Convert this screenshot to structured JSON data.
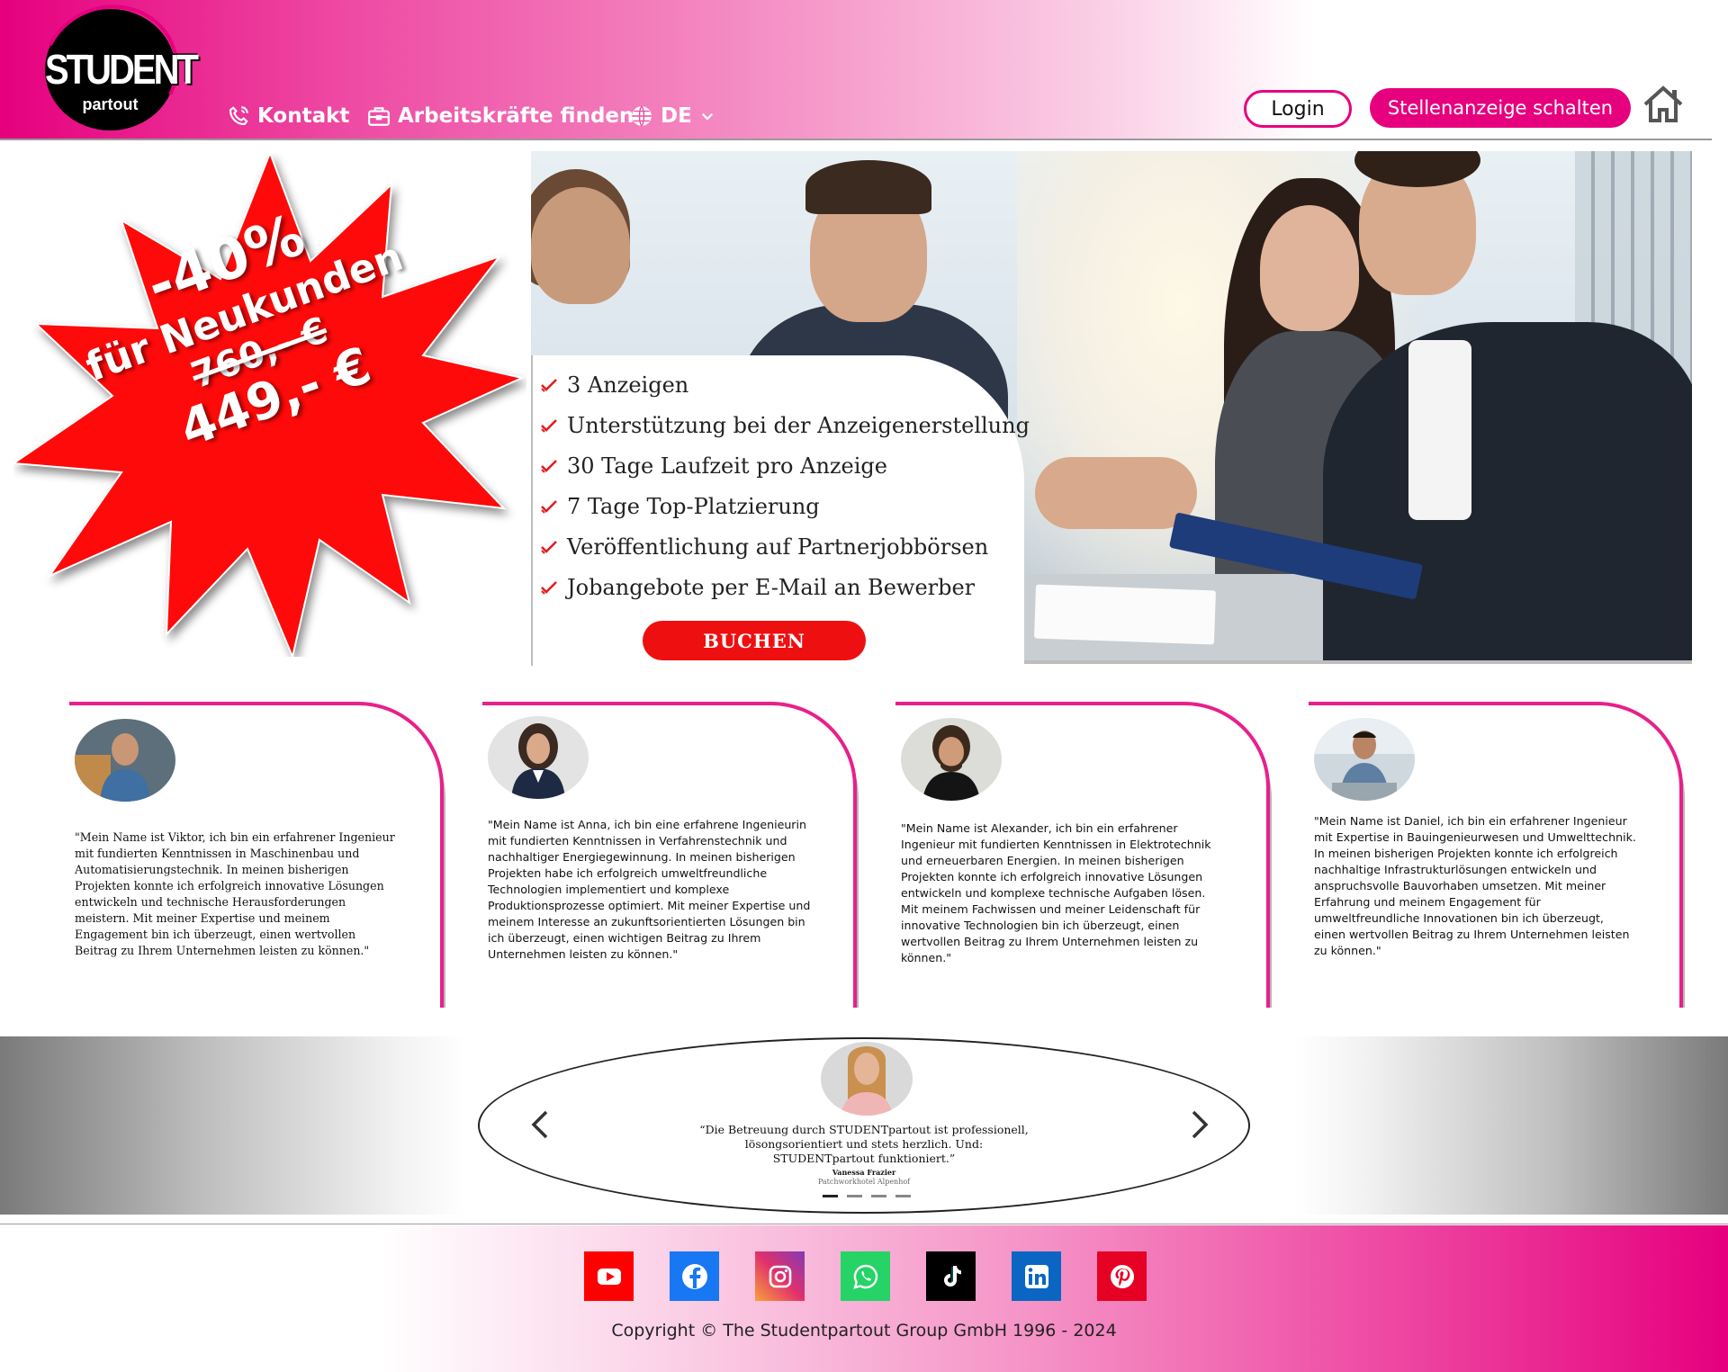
{
  "header": {
    "logo_title": "STUDENT",
    "logo_sub": "partout",
    "nav": {
      "contact": "Kontakt",
      "workers": "Arbeitskräfte finden",
      "language": "DE"
    },
    "login_label": "Login",
    "post_label": "Stellenanzeige schalten"
  },
  "promo": {
    "discount": "-40%",
    "audience": "für Neukunden",
    "old_price": "760,- €",
    "new_price": "449,- €"
  },
  "package": {
    "features": [
      "3 Anzeigen",
      "Unterstützung bei der Anzeigenerstellung",
      "30 Tage Laufzeit pro Anzeige",
      "7 Tage Top-Platzierung",
      "Veröffentlichung auf Partnerjobbörsen",
      "Jobangebote per E-Mail an Bewerber"
    ],
    "book_label": "BUCHEN"
  },
  "testimonials": [
    {
      "text": "\"Mein Name ist Viktor, ich bin ein erfahrener Ingenieur mit fundierten Kenntnissen in Maschinenbau und Automatisierungstechnik. In meinen bisherigen Projekten konnte ich erfolgreich innovative Lösungen entwickeln und technische Herausforderungen meistern. Mit meiner Expertise und meinem Engagement bin ich überzeugt, einen wertvollen Beitrag zu Ihrem Unternehmen leisten zu können.\""
    },
    {
      "text": "\"Mein Name ist Anna, ich bin eine erfahrene Ingenieurin mit fundierten Kenntnissen in Verfahrenstechnik und nachhaltiger Energiegewinnung. In meinen bisherigen Projekten habe ich erfolgreich umweltfreundliche Technologien implementiert und komplexe Produktionsprozesse optimiert. Mit meiner Expertise und meinem Interesse an zukunftsorientierten Lösungen bin ich überzeugt, einen wichtigen Beitrag zu Ihrem Unternehmen leisten zu können.\""
    },
    {
      "text": "\"Mein Name ist Alexander, ich bin ein erfahrener Ingenieur mit fundierten Kenntnissen in Elektrotechnik und erneuerbaren Energien. In meinen bisherigen Projekten konnte ich erfolgreich innovative Lösungen entwickeln und komplexe technische Aufgaben lösen. Mit meinem Fachwissen und meiner Leidenschaft für innovative Technologien bin ich überzeugt, einen wertvollen Beitrag zu Ihrem Unternehmen leisten zu können.\""
    },
    {
      "text": "\"Mein Name ist Daniel, ich bin ein erfahrener Ingenieur mit Expertise in Bauingenieurwesen und Umwelttechnik. In meinen bisherigen Projekten konnte ich erfolgreich nachhaltige Infrastrukturlösungen entwickeln und anspruchsvolle Bauvorhaben umsetzen. Mit meiner Erfahrung und meinem Engagement für umweltfreundliche Innovationen bin ich überzeugt, einen wertvollen Beitrag zu Ihrem Unternehmen leisten zu können.\""
    }
  ],
  "slider": {
    "quote": "“Die Betreuung durch STUDENTpartout ist professionell, lösongsorientiert und stets herzlich. Und: STUDENTpartout funktioniert.”",
    "name": "Vanessa Frazier",
    "company": "Patchworkhotel Alpenhof",
    "slides_count": 4,
    "active_slide": 1
  },
  "footer": {
    "socials": [
      "youtube-icon",
      "facebook-icon",
      "instagram-icon",
      "whatsapp-icon",
      "tiktok-icon",
      "linkedin-icon",
      "pinterest-icon"
    ],
    "copyright": "Copyright © The Studentpartout Group GmbH 1996 - 2024"
  },
  "colors": {
    "brand_pink": "#e6007e",
    "promo_red": "#ee1010",
    "youtube": "#ff0000",
    "facebook": "#1877f2",
    "whatsapp": "#25d366",
    "tiktok": "#000000",
    "linkedin": "#0a66c2",
    "pinterest": "#e60023"
  }
}
